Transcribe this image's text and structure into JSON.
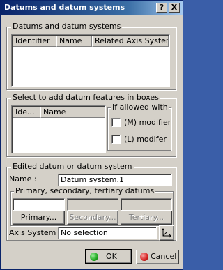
{
  "window": {
    "title": "Datums and datum systems",
    "help_label": "?",
    "close_label": "X"
  },
  "datum_systems": {
    "legend": "Datums and datum systems",
    "columns": [
      "Identifier",
      "Name",
      "Related Axis System"
    ]
  },
  "datum_features": {
    "legend": "Select to add datum features in boxes",
    "columns": [
      "Ide...",
      "Name"
    ],
    "modifiers": {
      "legend": "If allowed with",
      "m_label": "(M) modifier",
      "l_label": "(L) modifer"
    }
  },
  "edited": {
    "legend": "Edited datum or datum system",
    "name_label": "Name :",
    "name_value": "Datum system.1",
    "pst": {
      "legend": "Primary, secondary, tertiary datums",
      "primary_label": "Primary...",
      "secondary_label": "Secondary...",
      "tertiary_label": "Tertiary..."
    },
    "axis_label": "Axis System :",
    "axis_value": "No selection"
  },
  "footer": {
    "ok_label": "OK",
    "cancel_label": "Cancel"
  },
  "colors": {
    "title_start": "#0a246a",
    "ok_icon": "#1ea71e",
    "cancel_icon": "#d41f1f"
  }
}
